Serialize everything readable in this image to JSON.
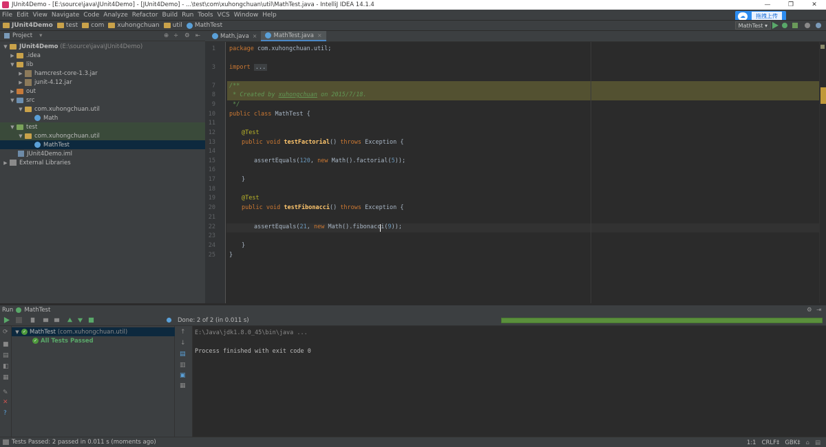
{
  "window": {
    "title": "JUnit4Demo - [E:\\source\\java\\JUnit4Demo] - [JUnit4Demo] - ...\\test\\com\\xuhongchuan\\util\\MathTest.java - IntelliJ IDEA 14.1.4",
    "minimize": "—",
    "restore": "❐",
    "close": "✕"
  },
  "menu": [
    "File",
    "Edit",
    "View",
    "Navigate",
    "Code",
    "Analyze",
    "Refactor",
    "Build",
    "Run",
    "Tools",
    "VCS",
    "Window",
    "Help"
  ],
  "upload": {
    "label": "拖拽上传"
  },
  "breadcrumbs": [
    "JUnit4Demo",
    "test",
    "com",
    "xuhongchuan",
    "util",
    "MathTest"
  ],
  "run_config": "MathTest ▾",
  "project": {
    "header": "Project",
    "tree": [
      {
        "label": "JUnit4Demo",
        "extra": "(E:\\source\\java\\JUnit4Demo)"
      },
      {
        "label": ".idea"
      },
      {
        "label": "lib"
      },
      {
        "label": "hamcrest-core-1.3.jar"
      },
      {
        "label": "junit-4.12.jar"
      },
      {
        "label": "out"
      },
      {
        "label": "src"
      },
      {
        "label": "com.xuhongchuan.util"
      },
      {
        "label": "Math"
      },
      {
        "label": "test"
      },
      {
        "label": "com.xuhongchuan.util"
      },
      {
        "label": "MathTest"
      },
      {
        "label": "JUnit4Demo.iml"
      },
      {
        "label": "External Libraries"
      }
    ]
  },
  "tabs": [
    {
      "label": "Math.java"
    },
    {
      "label": "MathTest.java"
    }
  ],
  "editor": {
    "line_numbers": [
      "1",
      "3",
      "7",
      "8",
      "9",
      "10",
      "11",
      "12",
      "13",
      "14",
      "15",
      "16",
      "17",
      "18",
      "19",
      "20",
      "21",
      "22",
      "23",
      "24",
      "25"
    ],
    "code": {
      "l1_kw": "package",
      "l1_rest": " com.xuhongchuan.util;",
      "l3_kw": "import",
      "l3_fold": "...",
      "l7": "/**",
      "l8_a": " * Created by ",
      "l8_user": "xuhongchuan",
      "l8_b": " on 2015/7/18.",
      "l9": " */",
      "l10_kw": "public class",
      "l10_rest": " MathTest {",
      "l12_ann": "@Test",
      "l13_kw1": "public void",
      "l13_fn": "testFactorial",
      "l13_mid": "() ",
      "l13_kw2": "throws",
      "l13_end": " Exception {",
      "l15_a": "assertEquals(",
      "l15_num1": "120",
      "l15_b": ", ",
      "l15_kw": "new",
      "l15_c": " Math().factorial(",
      "l15_num2": "5",
      "l15_d": "));",
      "l17": "}",
      "l19_ann": "@Test",
      "l20_kw1": "public void",
      "l20_fn": "testFibonacci",
      "l20_mid": "() ",
      "l20_kw2": "throws",
      "l20_end": " Exception {",
      "l22_a": "assertEquals(",
      "l22_num1": "21",
      "l22_b": ", ",
      "l22_kw": "new",
      "l22_c": " Math().fibonacci(",
      "l22_num2": "9",
      "l22_d": "));",
      "l24": "}",
      "l25": "}"
    }
  },
  "run": {
    "header_label": "Run",
    "header_config": "MathTest",
    "status": "Done: 2 of 2 (in 0.011 s)",
    "tree_root": "MathTest",
    "tree_root_pkg": "(com.xuhongchuan.util)",
    "tree_child": "All Tests Passed",
    "console": [
      "E:\\Java\\jdk1.8.0_45\\bin\\java ...",
      "Process finished with exit code 0"
    ]
  },
  "statusbar": {
    "message": "Tests Passed: 2 passed in 0.011 s (moments ago)",
    "position": "1:1",
    "line_sep": "CRLF‡",
    "encoding": "GBK‡"
  },
  "colors": {
    "accent": "#4a88c7",
    "pass_green": "#5a8f3c",
    "keyword": "#cc7832",
    "annotation": "#bbb529",
    "number": "#6897bb",
    "comment": "#629755"
  }
}
